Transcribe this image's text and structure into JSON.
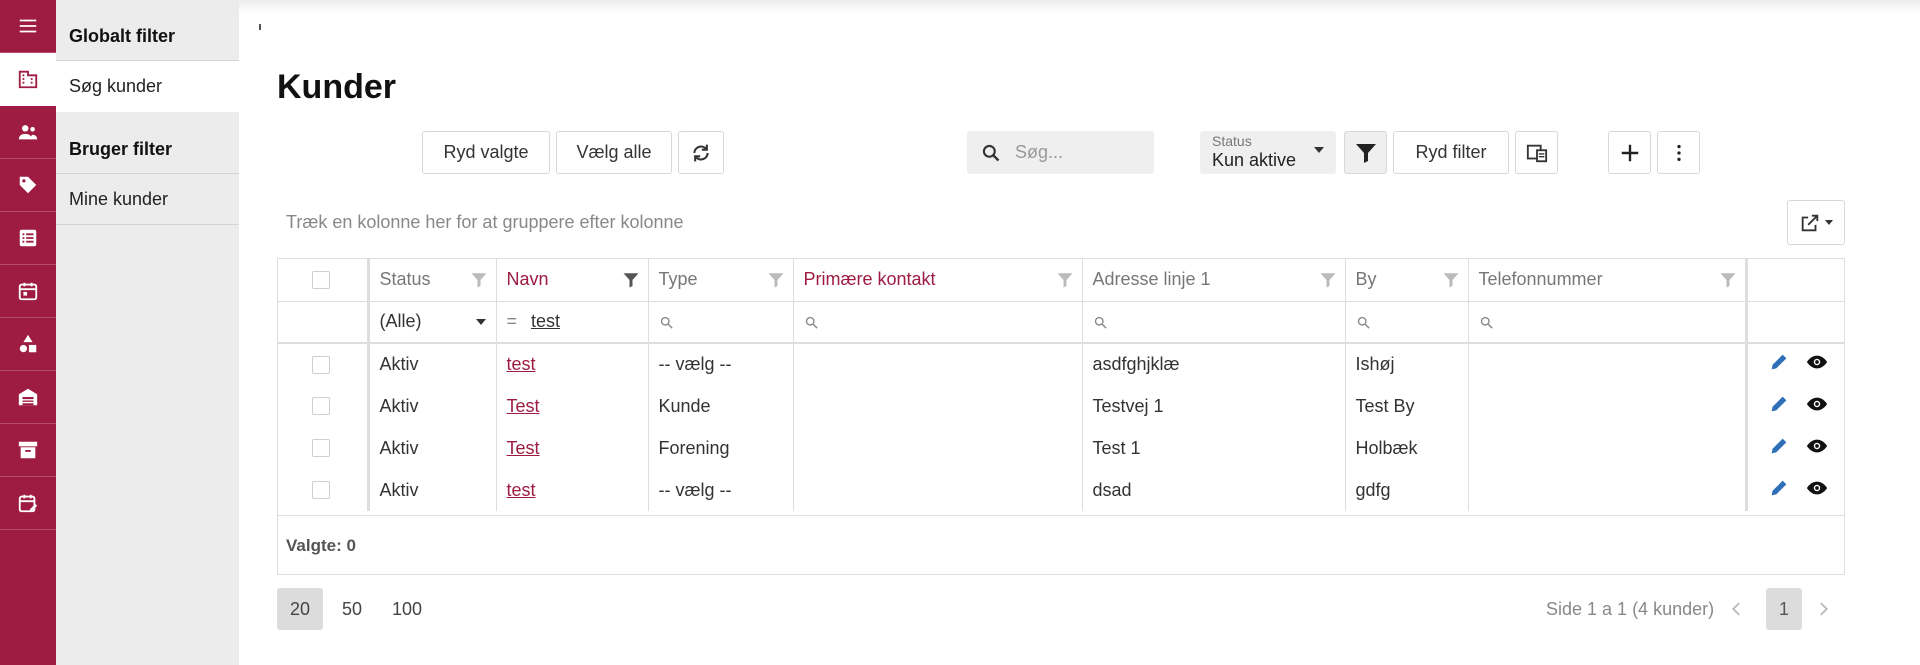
{
  "sidebar": {
    "global_filter_title": "Globalt filter",
    "search_customers": "Søg kunder",
    "user_filter_title": "Bruger filter",
    "my_customers": "Mine kunder"
  },
  "page": {
    "title": "Kunder"
  },
  "toolbar": {
    "clear_selected": "Ryd valgte",
    "select_all": "Vælg alle",
    "search_placeholder": "Søg...",
    "status_label": "Status",
    "status_value": "Kun aktive",
    "clear_filter": "Ryd filter"
  },
  "grid": {
    "group_hint": "Træk en kolonne her for at gruppere efter kolonne",
    "columns": [
      "Status",
      "Navn",
      "Type",
      "Primære kontakt",
      "Adresse linje 1",
      "By",
      "Telefonnummer"
    ],
    "filters": {
      "status": "(Alle)",
      "name_operator": "=",
      "name": "test"
    },
    "rows": [
      {
        "status": "Aktiv",
        "name": "test",
        "type": "-- vælg --",
        "contact": "",
        "address": "asdfghjklæ",
        "city": "Ishøj",
        "phone": ""
      },
      {
        "status": "Aktiv",
        "name": "Test",
        "type": "Kunde",
        "contact": "",
        "address": "Testvej 1",
        "city": "Test By",
        "phone": ""
      },
      {
        "status": "Aktiv",
        "name": "Test",
        "type": "Forening",
        "contact": "",
        "address": "Test 1",
        "city": "Holbæk",
        "phone": ""
      },
      {
        "status": "Aktiv",
        "name": "test",
        "type": "-- vælg --",
        "contact": "",
        "address": "dsad",
        "city": "gdfg",
        "phone": ""
      }
    ],
    "selected_count_label": "Valgte: 0"
  },
  "pager": {
    "sizes": [
      "20",
      "50",
      "100"
    ],
    "info": "Side 1 a 1 (4 kunder)",
    "current": "1"
  },
  "colors": {
    "brand": "#9e1b42",
    "action_blue": "#2e6fb8"
  }
}
